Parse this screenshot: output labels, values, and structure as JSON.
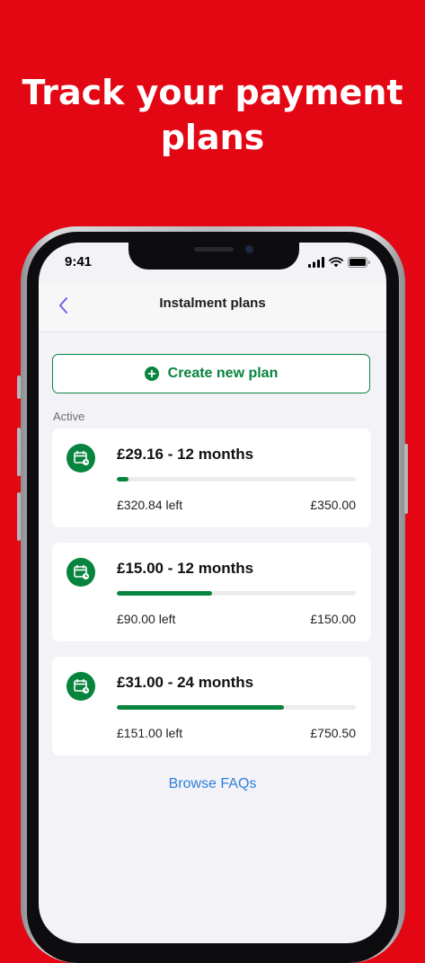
{
  "headline": "Track your payment plans",
  "status_bar": {
    "time": "9:41"
  },
  "nav": {
    "title": "Instalment plans"
  },
  "create_button": {
    "label": "Create new plan"
  },
  "section": {
    "label": "Active"
  },
  "plans": [
    {
      "title": "£29.16 - 12 months",
      "left": "£320.84 left",
      "total": "£350.00",
      "progress": 0.05
    },
    {
      "title": "£15.00 - 12 months",
      "left": "£90.00 left",
      "total": "£150.00",
      "progress": 0.4
    },
    {
      "title": "£31.00 - 24 months",
      "left": "£151.00 left",
      "total": "£750.50",
      "progress": 0.7
    }
  ],
  "faq_link": "Browse FAQs",
  "colors": {
    "brand_red": "#e30613",
    "accent_green": "#07843e",
    "link_blue": "#2f80d8"
  },
  "icons": {
    "back": "chevron-left-icon",
    "add": "plus-circle-icon",
    "plan": "calendar-icon"
  }
}
